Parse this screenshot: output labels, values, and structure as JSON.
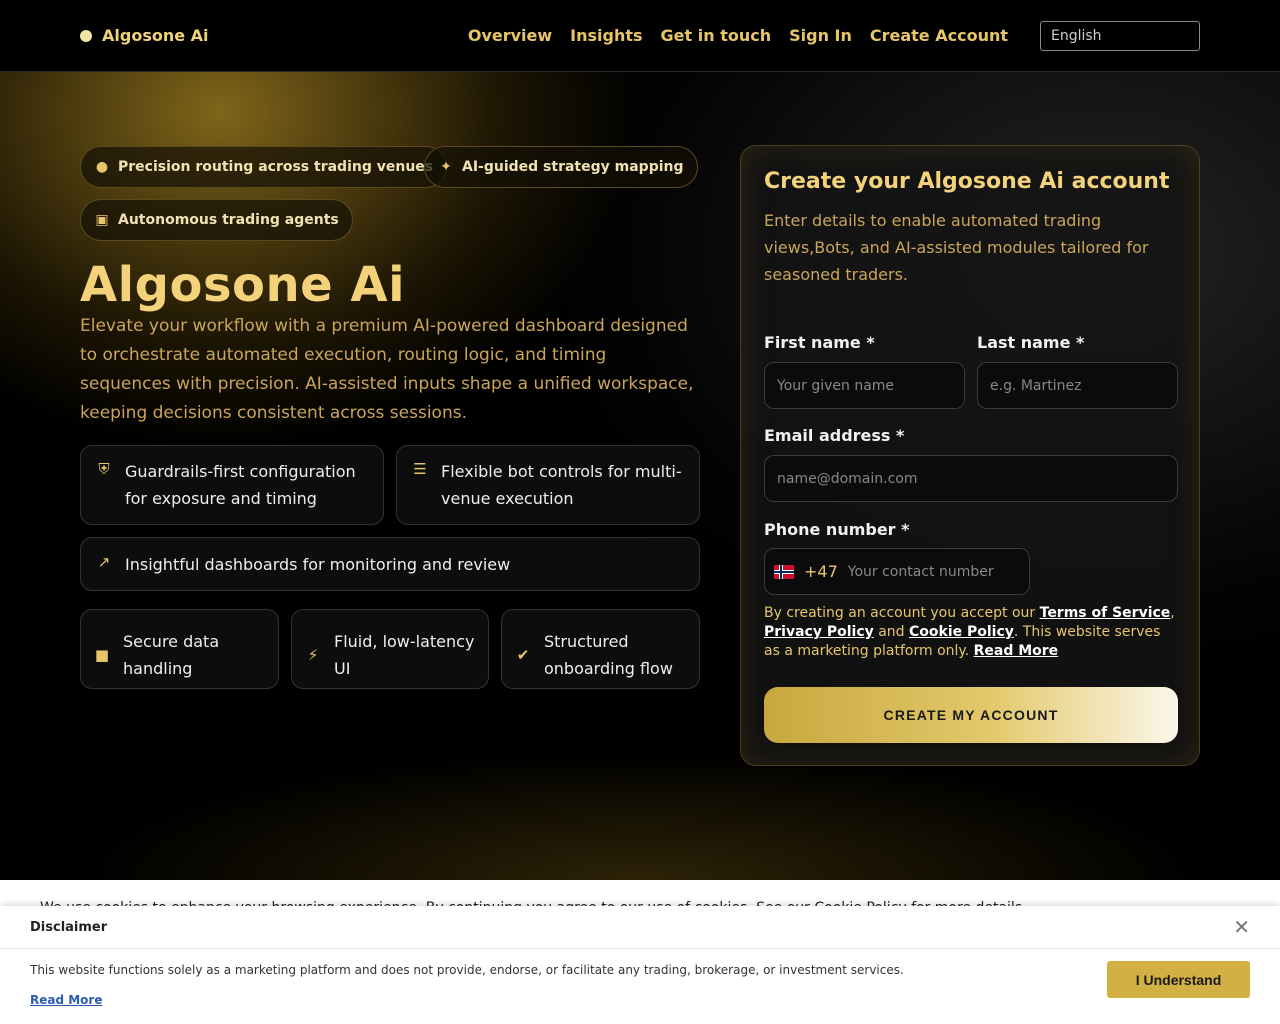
{
  "nav": {
    "brand": "Algosone Ai",
    "links": [
      "Overview",
      "Insights",
      "Get in touch",
      "Sign In",
      "Create Account"
    ],
    "language": "English"
  },
  "hero": {
    "pills": [
      {
        "icon": "coins-icon",
        "label": "Precision routing across trading venues"
      },
      {
        "icon": "magic-wand-icon",
        "label": "AI-guided strategy mapping"
      },
      {
        "icon": "robot-icon",
        "label": "Autonomous trading agents"
      }
    ],
    "title": "Algosone Ai",
    "description": "Elevate your workflow with a premium AI-powered dashboard designed to orchestrate automated execution, routing logic, and timing sequences with precision. AI-assisted inputs shape a unified workspace, keeping decisions consistent across sessions.",
    "features": [
      {
        "icon": "shield-icon",
        "label": "Guardrails-first configuration for exposure and timing"
      },
      {
        "icon": "sliders-icon",
        "label": "Flexible bot controls for multi-venue execution"
      },
      {
        "icon": "chart-line-icon",
        "label": "Insightful dashboards for monitoring and review"
      },
      {
        "icon": "lock-icon",
        "label": "Secure data handling"
      },
      {
        "icon": "bolt-icon",
        "label": "Fluid, low-latency UI"
      },
      {
        "icon": "check-circle-icon",
        "label": "Structured onboarding flow"
      }
    ]
  },
  "form": {
    "title": "Create your Algosone Ai account",
    "subtitle": "Enter details to enable automated trading views,Bots, and AI-assisted modules tailored for seasoned traders.",
    "first_name_label": "First name *",
    "first_name_placeholder": "Your given name",
    "last_name_label": "Last name *",
    "last_name_placeholder": "e.g. Martinez",
    "email_label": "Email address *",
    "email_placeholder": "name@domain.com",
    "phone_label": "Phone number *",
    "phone_dial_code": "+47",
    "phone_placeholder": "Your contact number",
    "terms_prefix": "By creating an account you accept our ",
    "terms_link": "Terms of Service",
    "terms_comma": ",",
    "privacy_link": "Privacy Policy",
    "terms_and": " and ",
    "cookie_link": "Cookie Policy",
    "terms_suffix": ". This website serves as a marketing platform only. ",
    "read_more": "Read More",
    "submit": "CREATE MY ACCOUNT"
  },
  "cookie_strip_text": "We use cookies to enhance your browsing experience. By continuing you agree to our use of cookies. See our Cookie Policy for more details.",
  "disclaimer": {
    "title": "Disclaimer",
    "text": "This website functions solely as a marketing platform and does not provide, endorse, or facilitate any trading, brokerage, or investment services.",
    "read_more": "Read More",
    "button": "I Understand"
  }
}
